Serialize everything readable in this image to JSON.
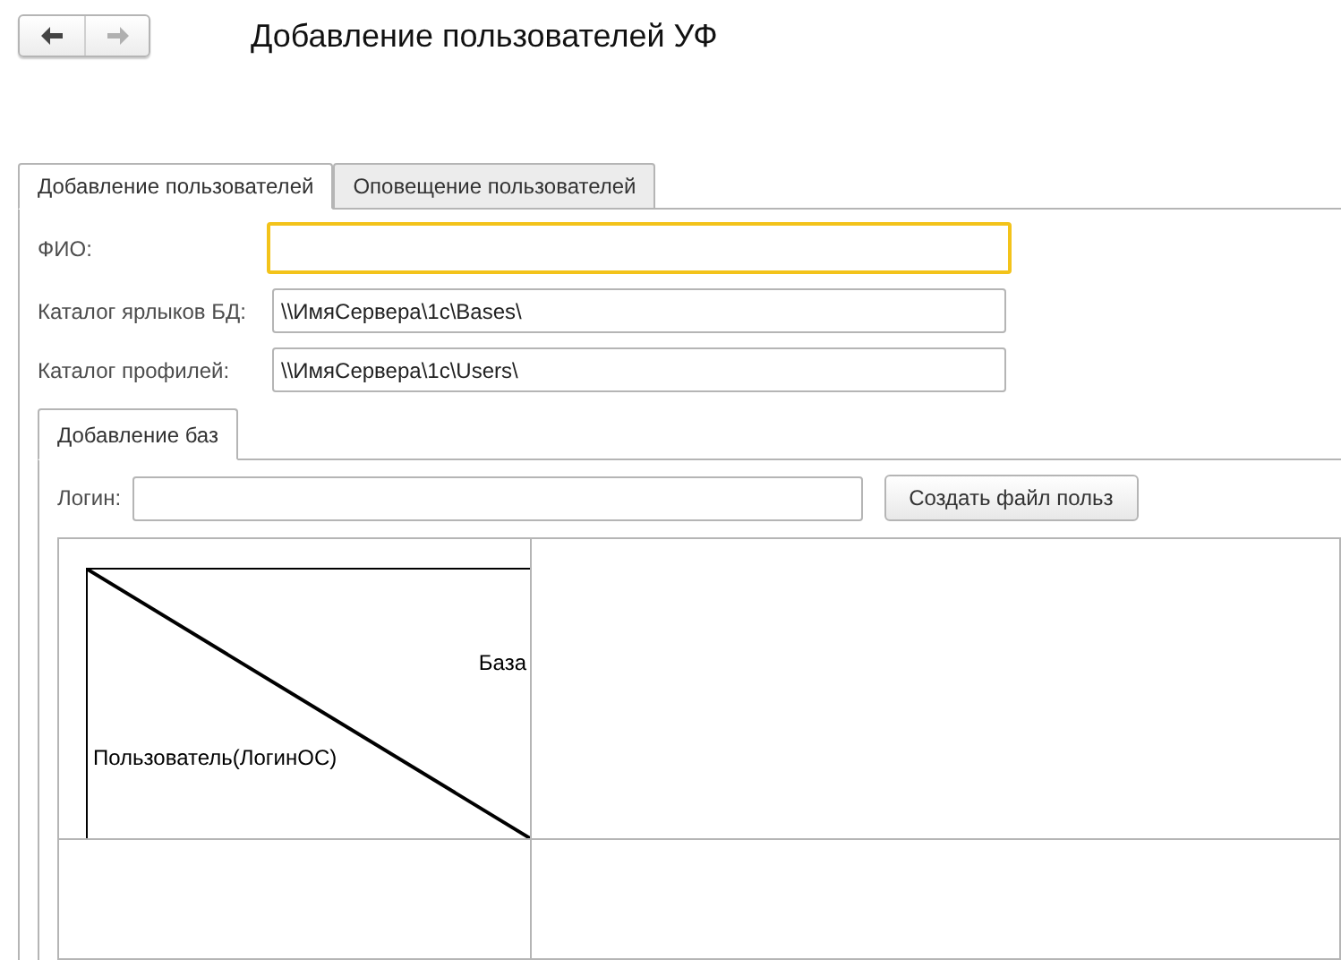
{
  "nav_buttons": [
    {
      "kind": "back",
      "disabled": false
    },
    {
      "kind": "forward",
      "disabled": true
    }
  ],
  "window": {
    "title": "Добавление пользователей УФ"
  },
  "tabs": [
    {
      "label": "Добавление пользователей",
      "selected": true
    },
    {
      "label": "Оповещение пользователей",
      "selected": false
    }
  ],
  "fields": [
    {
      "label": "ФИО:",
      "focused": true
    },
    {
      "label": "Каталог ярлыков БД:",
      "value": "\\\\ИмяСервера\\1c\\Bases\\",
      "focused": false
    },
    {
      "label": "Каталог профилей:",
      "value": "\\\\ИмяСервера\\1c\\Users\\",
      "focused": false
    }
  ],
  "inner_tabs": [
    {
      "label": "Добавление баз",
      "selected": true
    }
  ],
  "login": {
    "label": "Логин:"
  },
  "create_button": "Создать файл польз",
  "grid": {
    "column_header": "База",
    "row_header": "Пользователь(ЛогинОС)"
  }
}
